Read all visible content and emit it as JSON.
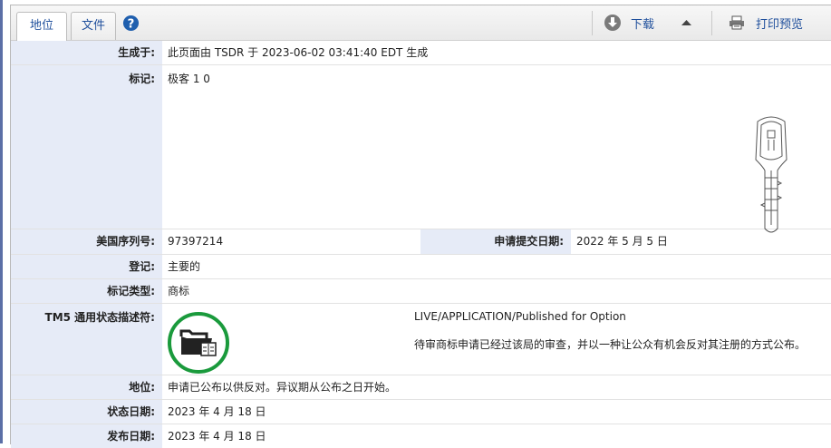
{
  "tabs": [
    {
      "label": "地位",
      "active": true
    },
    {
      "label": "文件",
      "active": false
    }
  ],
  "toolbar": {
    "help_icon": "question-circle-icon",
    "download_label": "下载",
    "download_icon": "download-arrow-icon",
    "print_label": "打印预览",
    "print_icon": "printer-icon"
  },
  "rows": {
    "generated_label": "生成于:",
    "generated_value": "此页面由 TSDR 于 2023-06-02 03:41:40 EDT 生成",
    "mark_label": "标记:",
    "mark_value": "极客 1 0",
    "serial_label": "美国序列号:",
    "serial_value": "97397214",
    "filing_date_label": "申请提交日期:",
    "filing_date_value": "2022 年 5 月 5 日",
    "register_label": "登记:",
    "register_value": "主要的",
    "mark_type_label": "标记类型:",
    "mark_type_value": "商标",
    "tm5_label": "TM5 通用状态描述符:",
    "tm5_status_code": "LIVE/APPLICATION/Published for Option",
    "tm5_description": "待审商标申请已经过该局的审查，并以一种让公众有机会反对其注册的方式公布。",
    "status_label": "地位:",
    "status_value": "申请已公布以供反对。异议期从公布之日开始。",
    "status_date_label": "状态日期:",
    "status_date_value": "2023 年 4 月 18 日",
    "publication_date_label": "发布日期:",
    "publication_date_value": "2023 年 4 月 18 日"
  },
  "colors": {
    "label_bg": "#e6ebf7",
    "link": "#1f4f9c",
    "status_ring": "#1a9a3c"
  }
}
